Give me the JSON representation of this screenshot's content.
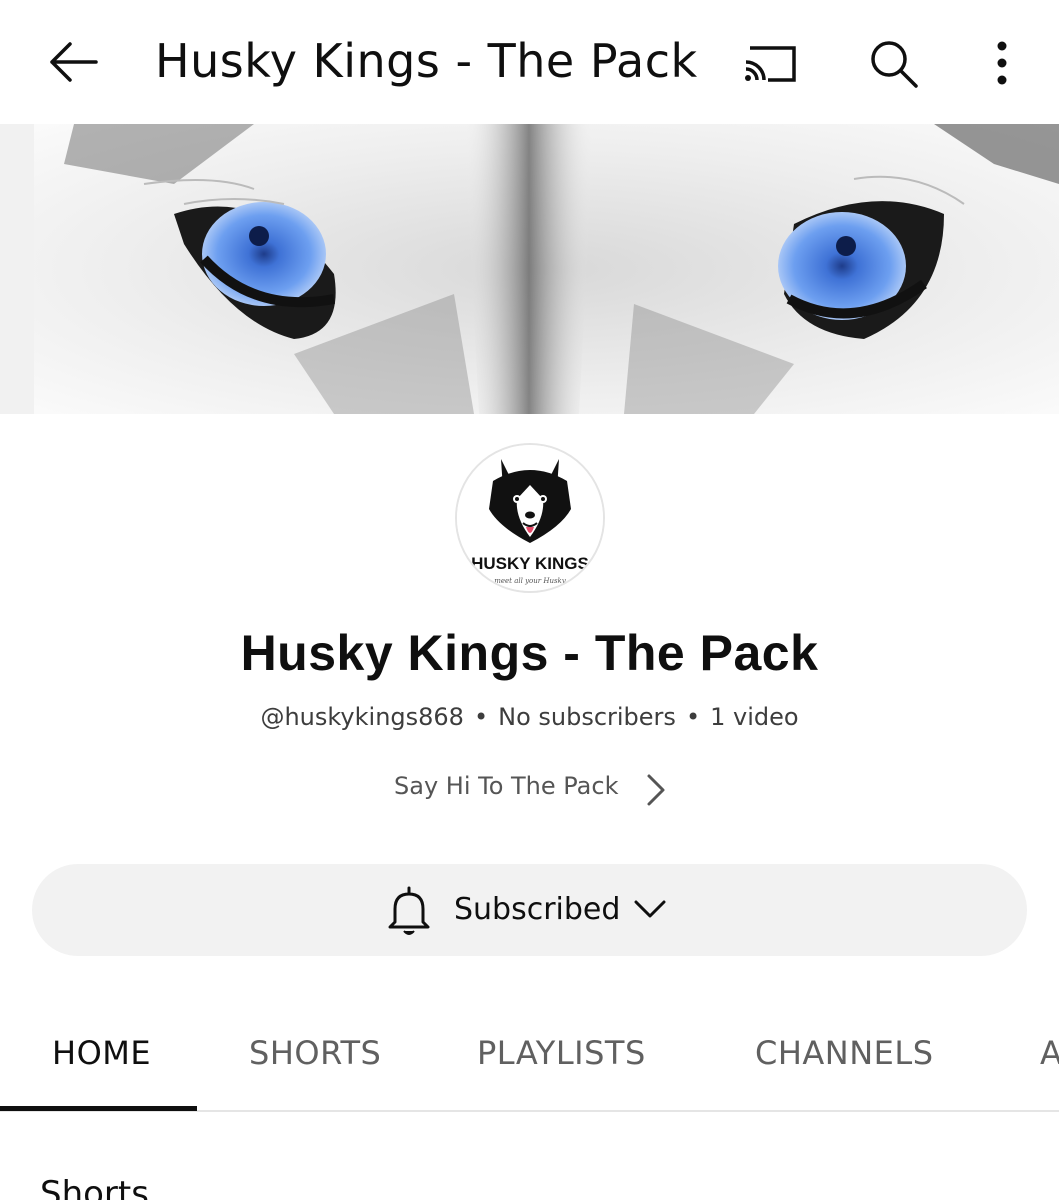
{
  "header": {
    "title": "Husky Kings - The Pack"
  },
  "icons": {
    "back": "arrow-back-icon",
    "cast": "cast-icon",
    "search": "search-icon",
    "more": "more-vertical-icon",
    "bell": "bell-icon",
    "caret": "chevron-down-icon",
    "about_chevron": "chevron-right-icon"
  },
  "banner": {
    "eye_color": "#5b8fe6"
  },
  "avatar": {
    "logo_text": "HUSKY KINGS",
    "logo_tagline": "meet all your Husky"
  },
  "channel": {
    "name": "Husky Kings - The Pack",
    "handle": "@huskykings868",
    "subscribers": "No subscribers",
    "videos": "1 video",
    "separator": "•",
    "about_link": "Say Hi To The Pack"
  },
  "subscribe_button": {
    "label": "Subscribed"
  },
  "tabs": [
    {
      "label": "HOME",
      "active": true
    },
    {
      "label": "SHORTS",
      "active": false
    },
    {
      "label": "PLAYLISTS",
      "active": false
    },
    {
      "label": "CHANNELS",
      "active": false
    },
    {
      "label": "A",
      "active": false
    }
  ],
  "section": {
    "title": "Shorts"
  },
  "colors": {
    "text_primary": "#0f0f0f",
    "text_secondary": "#606060",
    "pill_bg": "#f2f2f2"
  }
}
